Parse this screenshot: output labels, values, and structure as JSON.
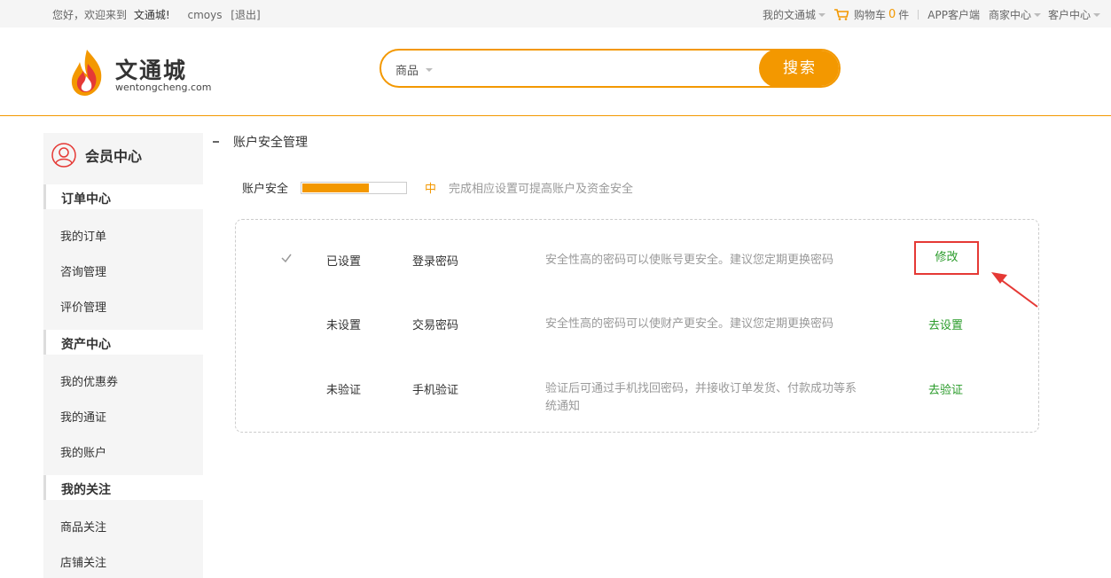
{
  "topbar": {
    "greeting": "您好，欢迎来到",
    "site_name": "文通城!",
    "username": "cmoys",
    "logout": "[退出]",
    "my_site": "我的文通城",
    "cart_label": "购物车",
    "cart_count": "0",
    "cart_unit": "件",
    "app": "APP客户端",
    "merchant": "商家中心",
    "customer": "客户中心"
  },
  "logo": {
    "name": "文通城",
    "domain": "wentongcheng.com"
  },
  "search": {
    "category": "商品",
    "placeholder": "",
    "button": "搜索"
  },
  "sidebar": {
    "title": "会员中心",
    "groups": [
      {
        "label": "订单中心",
        "items": [
          "我的订单",
          "咨询管理",
          "评价管理"
        ]
      },
      {
        "label": "资产中心",
        "items": [
          "我的优惠券",
          "我的通证",
          "我的账户"
        ]
      },
      {
        "label": "我的关注",
        "items": [
          "商品关注",
          "店铺关注"
        ]
      }
    ]
  },
  "main": {
    "section_title": "账户安全管理",
    "security": {
      "label": "账户安全",
      "level": "中",
      "level_fraction": 0.65,
      "hint": "完成相应设置可提高账户及资金安全"
    },
    "rows": [
      {
        "status": "已设置",
        "item": "登录密码",
        "desc": "安全性高的密码可以使账号更安全。建议您定期更换密码",
        "action": "修改"
      },
      {
        "status": "未设置",
        "item": "交易密码",
        "desc": "安全性高的密码可以使财产更安全。建议您定期更换密码",
        "action": "去设置"
      },
      {
        "status": "未验证",
        "item": "手机验证",
        "desc": "验证后可通过手机找回密码，并接收订单发货、付款成功等系统通知",
        "action": "去验证"
      }
    ]
  },
  "colors": {
    "accent": "#f39800",
    "action_green": "#2a9b2a",
    "highlight_red": "#e53935"
  }
}
